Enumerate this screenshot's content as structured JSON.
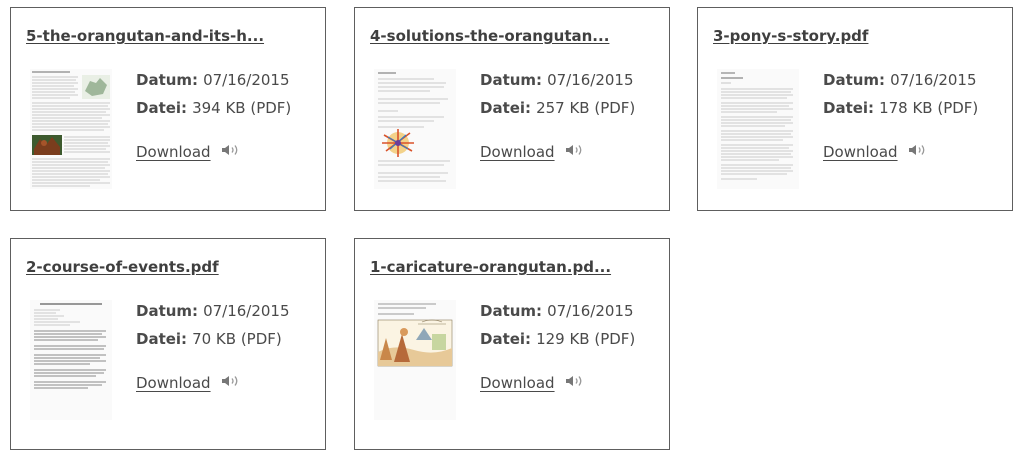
{
  "labels": {
    "date": "Datum:",
    "file": "Datei:",
    "download": "Download"
  },
  "icons": {
    "speaker": "speaker-icon"
  },
  "colors": {
    "border": "#5e5e5e",
    "text": "#4a4a4a"
  },
  "cards": [
    {
      "title": "5-the-orangutan-and-its-h...",
      "date": "07/16/2015",
      "file": "394 KB (PDF)"
    },
    {
      "title": "4-solutions-the-orangutan...",
      "date": "07/16/2015",
      "file": "257 KB (PDF)"
    },
    {
      "title": "3-pony-s-story.pdf",
      "date": "07/16/2015",
      "file": "178 KB (PDF)"
    },
    {
      "title": "2-course-of-events.pdf",
      "date": "07/16/2015",
      "file": "70 KB (PDF)"
    },
    {
      "title": "1-caricature-orangutan.pd...",
      "date": "07/16/2015",
      "file": "129 KB (PDF)"
    }
  ]
}
